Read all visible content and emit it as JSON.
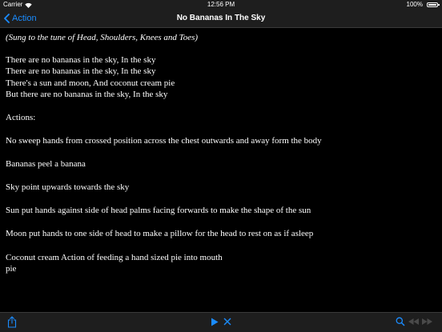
{
  "status_bar": {
    "carrier": "Carrier",
    "time": "12:56 PM",
    "battery": "100%"
  },
  "nav": {
    "back_label": "Action",
    "title": "No Bananas In The Sky"
  },
  "song": {
    "subtitle": "(Sung to the tune of Head, Shoulders, Knees and Toes)",
    "verse": [
      "There are no bananas in the sky, In the sky",
      "There are no bananas in the sky, In the sky",
      "There's a sun and moon, And coconut cream pie",
      "But there are no bananas in the sky, In the sky"
    ],
    "actions_heading": "Actions:",
    "actions": [
      "No sweep hands from crossed position across the chest outwards and away form the body",
      "Bananas peel a banana",
      "Sky point upwards towards the sky",
      "Sun put hands against side of head palms facing forwards to make the shape of the sun",
      "Moon put hands to one side of head to make a pillow for the head to rest on as if asleep"
    ],
    "last_action": [
      "Coconut cream Action of feeding a hand sized pie into mouth",
      "pie"
    ]
  },
  "toolbar": {
    "icons": [
      "share-icon",
      "play-icon",
      "close-icon",
      "search-icon",
      "rewind-icon",
      "fast-forward-icon"
    ],
    "accent_color": "#1a8cff",
    "disabled_color": "#4a4a4a"
  }
}
